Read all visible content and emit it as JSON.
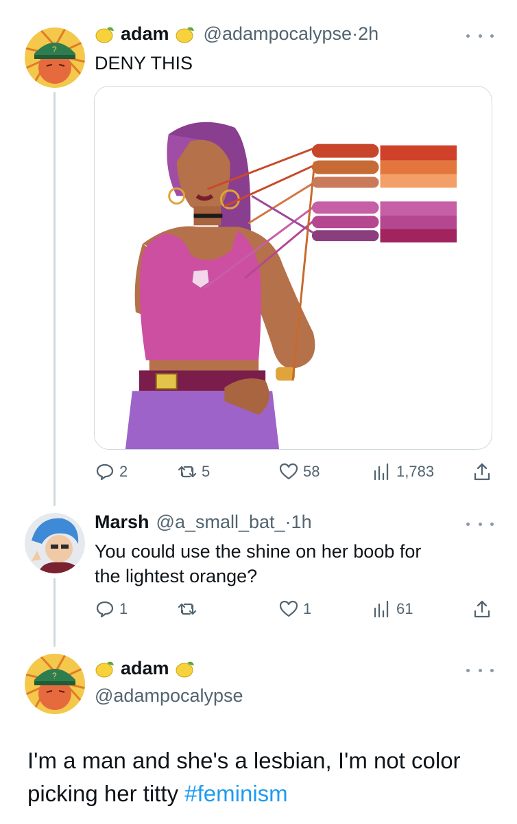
{
  "tweets": [
    {
      "name": "adam",
      "handle": "@adampocalypse",
      "time": "2h",
      "text": "DENY THIS",
      "stats": {
        "replies": "2",
        "retweets": "5",
        "likes": "58",
        "views": "1,783"
      }
    },
    {
      "name": "Marsh",
      "handle": "@a_small_bat_",
      "time": "1h",
      "text_line1": "You could use the shine on her boob for",
      "text_line2": "the lightest orange?",
      "stats": {
        "replies": "1",
        "retweets": "",
        "likes": "1",
        "views": "61"
      }
    },
    {
      "name": "adam",
      "handle": "@adampocalypse",
      "text_line1": "I'm a man and she's a lesbian, I'm not color",
      "text_line2_pre": "picking her titty ",
      "hashtag": "#feminism"
    }
  ],
  "colors": {
    "accent_link": "#1d9bf0",
    "text_secondary": "#536471",
    "palette_oranges": [
      "#d0412a",
      "#e2763d",
      "#f2a067"
    ],
    "palette_pinks": [
      "#c65fa6",
      "#b54790",
      "#a1245e"
    ]
  },
  "icons": [
    "lemon-emoji-icon",
    "more-dots-icon",
    "reply-icon",
    "retweet-icon",
    "like-icon",
    "views-icon",
    "share-icon"
  ]
}
